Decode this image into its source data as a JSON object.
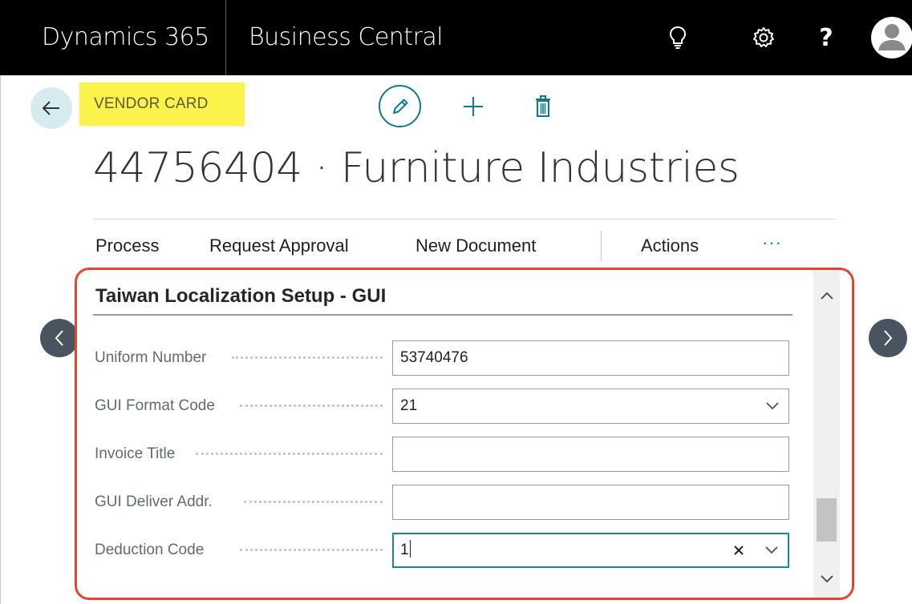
{
  "topbar": {
    "app_name": "Dynamics 365",
    "product_name": "Business Central",
    "icons": [
      "lightbulb-icon",
      "gear-icon",
      "help-icon",
      "avatar-icon"
    ],
    "help_glyph": "?"
  },
  "header": {
    "caption": "VENDOR CARD",
    "title": "44756404 · Furniture Industries",
    "actions": [
      "edit-icon",
      "add-icon",
      "delete-icon"
    ]
  },
  "menu": {
    "process": "Process",
    "request_approval": "Request Approval",
    "new_document": "New Document",
    "actions": "Actions",
    "more": "···"
  },
  "section": {
    "title": "Taiwan Localization Setup - GUI",
    "fields": [
      {
        "label": "Uniform Number",
        "value": ""
      },
      {
        "label": "GUI Format Code",
        "value": "21"
      },
      {
        "label": "Invoice Title",
        "value": ""
      },
      {
        "label": "GUI Deliver Addr.",
        "value": ""
      },
      {
        "label": "Deduction Code",
        "value": "1"
      }
    ],
    "uniform_number_value": "53740476"
  },
  "colors": {
    "topbar": "#000000",
    "accent": "#0e7c86",
    "caption_highlight": "#fbf34a",
    "panel_outline": "#e2462f",
    "nav_circle": "#4a5461"
  }
}
